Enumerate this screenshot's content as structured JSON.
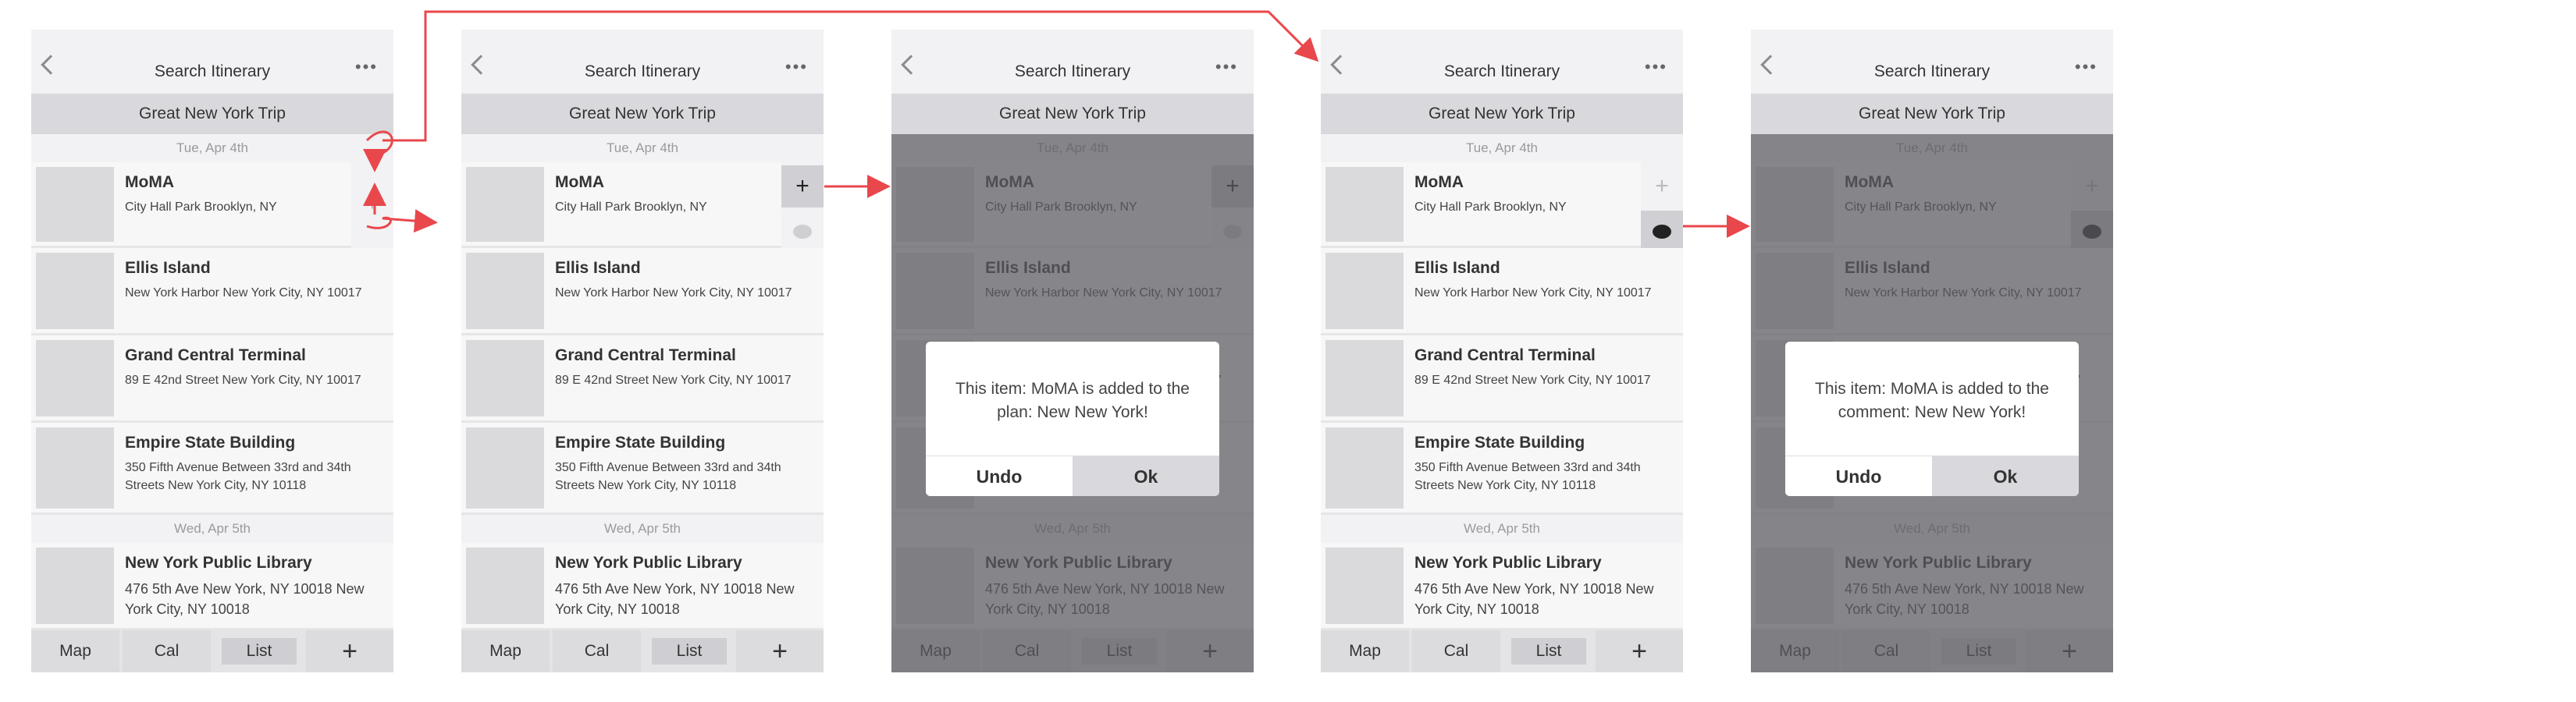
{
  "nav": {
    "title": "Search Itinerary",
    "more": "•••"
  },
  "trip": {
    "name": "Great New York Trip"
  },
  "dates": [
    "Tue, Apr 4th",
    "Wed, Apr 5th"
  ],
  "places": [
    {
      "name": "MoMA",
      "address": "City Hall Park Brooklyn, NY"
    },
    {
      "name": "Ellis Island",
      "address": "New York Harbor New York City, NY 10017"
    },
    {
      "name": "Grand Central Terminal",
      "address": "89 E 42nd Street New York City, NY 10017"
    },
    {
      "name": "Empire State Building",
      "address": "350 Fifth Avenue Between 33rd and 34th Streets New York City, NY 10118"
    },
    {
      "name": "New York Public Library",
      "address": "476 5th Ave New York, NY 10018 New York City, NY 10018"
    }
  ],
  "tabs": {
    "map": "Map",
    "cal": "Cal",
    "list": "List",
    "add": "+"
  },
  "row_actions": {
    "add": "+"
  },
  "dialogs": {
    "plan": {
      "message": "This item: MoMA is added to the plan: New New York!",
      "undo": "Undo",
      "ok": "Ok"
    },
    "comment": {
      "message": "This item: MoMA is added to the comment: New New York!",
      "undo": "Undo",
      "ok": "Ok"
    }
  },
  "colors": {
    "flow_arrow": "#e8474c",
    "overlay": "#5a5a5f",
    "tripbar": "#d9d9dd",
    "thumb": "#dadadd"
  }
}
